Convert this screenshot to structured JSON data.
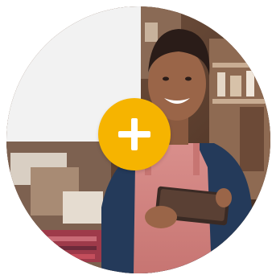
{
  "graphic": {
    "accent_color": "#f6b400",
    "quadrant_color": "#f2f2f2",
    "photo_subject": "smiling-shopkeeper-with-tablet",
    "center_icon": "plus-icon"
  }
}
